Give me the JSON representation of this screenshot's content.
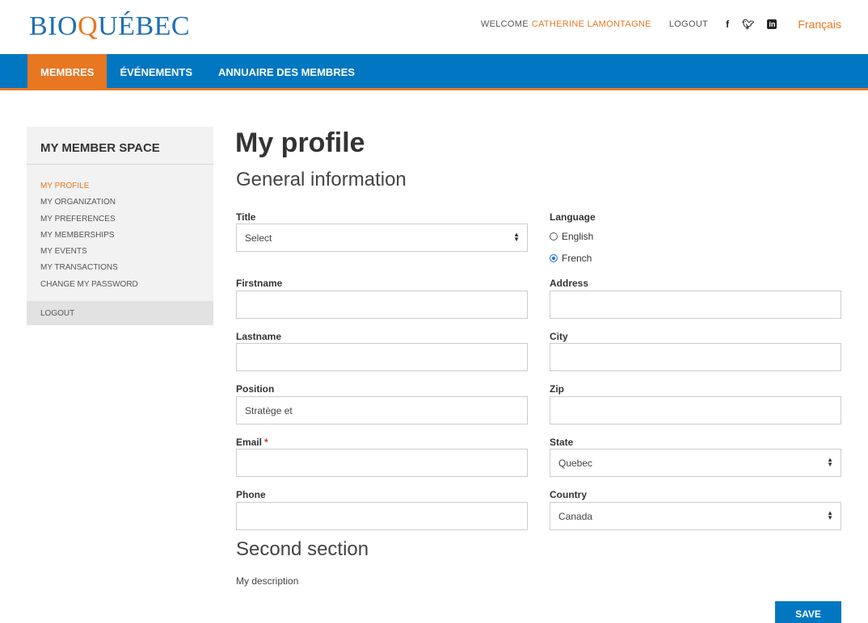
{
  "header": {
    "logo_text": "BIOQUÉBEC",
    "welcome": "WELCOME",
    "username": "CATHERINE LAMONTAGNE",
    "logout": "LOGOUT",
    "language_switch": "Français",
    "social_icons": [
      "facebook-icon",
      "twitter-icon",
      "linkedin-icon"
    ]
  },
  "nav": {
    "items": [
      "MEMBRES",
      "ÉVÉNEMENTS",
      "ANNUAIRE DES MEMBRES"
    ],
    "active_index": 0
  },
  "sidebar": {
    "title": "MY MEMBER SPACE",
    "items": [
      "MY PROFILE",
      "MY ORGANIZATION",
      "MY PREFERENCES",
      "MY MEMBERSHIPS",
      "MY EVENTS",
      "MY TRANSACTIONS",
      "CHANGE MY PASSWORD"
    ],
    "active_index": 0,
    "logout": "LOGOUT"
  },
  "main": {
    "page_title": "My profile",
    "section1_title": "General information",
    "section2_title": "Second section",
    "description_label": "My description",
    "save_label": "SAVE"
  },
  "form": {
    "title": {
      "label": "Title",
      "value": "Select"
    },
    "firstname": {
      "label": "Firstname",
      "value": ""
    },
    "lastname": {
      "label": "Lastname",
      "value": ""
    },
    "position": {
      "label": "Position",
      "value": "Stratège et"
    },
    "email": {
      "label": "Email",
      "required_mark": "*",
      "value": ""
    },
    "phone": {
      "label": "Phone",
      "value": ""
    },
    "language": {
      "label": "Language",
      "options": [
        "English",
        "French"
      ],
      "selected": "French"
    },
    "address": {
      "label": "Address",
      "value": ""
    },
    "city": {
      "label": "City",
      "value": ""
    },
    "zip": {
      "label": "Zip",
      "value": ""
    },
    "state": {
      "label": "State",
      "value": "Quebec"
    },
    "country": {
      "label": "Country",
      "value": "Canada"
    }
  },
  "colors": {
    "brand_blue": "#0077c0",
    "accent_orange": "#e87722",
    "sidebar_bg": "#f2f2f2"
  }
}
